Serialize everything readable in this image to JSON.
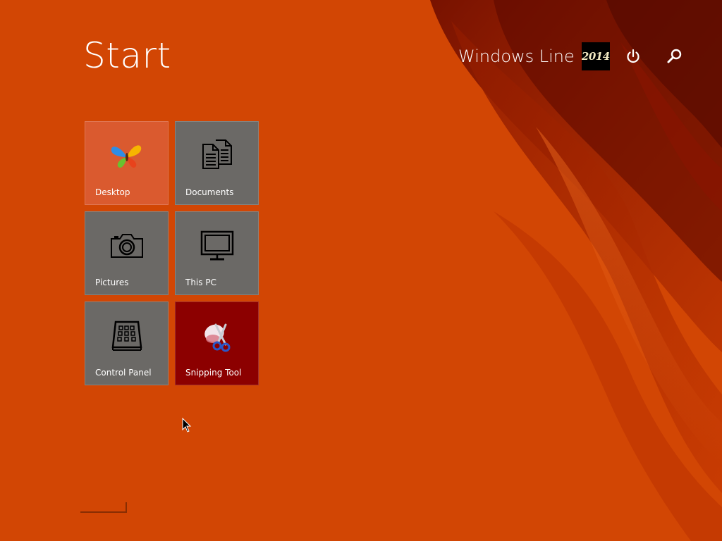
{
  "screen": {
    "title": "Start",
    "background_color": "#d24604",
    "accent_color": "#7a0e00"
  },
  "user": {
    "name": "Windows Line",
    "avatar_text": "2014"
  },
  "top_icons": [
    {
      "name": "power-icon",
      "glyph": "power"
    },
    {
      "name": "search-icon",
      "glyph": "search"
    }
  ],
  "tiles": [
    {
      "label": "Desktop",
      "icon": "butterfly-icon",
      "color": "#da5a2f"
    },
    {
      "label": "Documents",
      "icon": "documents-icon",
      "color": "#6b6966"
    },
    {
      "label": "Pictures",
      "icon": "camera-icon",
      "color": "#6b6966"
    },
    {
      "label": "This PC",
      "icon": "monitor-icon",
      "color": "#6b6966"
    },
    {
      "label": "Control Panel",
      "icon": "control-panel-icon",
      "color": "#6b6966"
    },
    {
      "label": "Snipping Tool",
      "icon": "scissors-icon",
      "color": "#8c0000"
    }
  ]
}
